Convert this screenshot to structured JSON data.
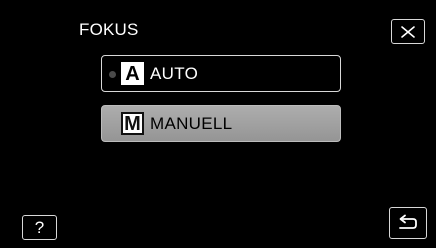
{
  "screen": {
    "title": "FOKUS"
  },
  "options": [
    {
      "label": "AUTO",
      "badge": "A",
      "state": "selected-indicator",
      "style": "dark"
    },
    {
      "label": "MANUELL",
      "badge": "M",
      "state": "highlighted",
      "style": "gray"
    }
  ],
  "controls": {
    "close_icon": "close-icon",
    "help_label": "?",
    "help_icon": "question-mark-icon",
    "back_icon": "return-arrow-icon"
  },
  "colors": {
    "background": "#000000",
    "text_light": "#ffffff",
    "border_light": "#d8d8d8",
    "highlight_gray": "#a5a5a5",
    "dot_gray": "#4a4a4a"
  }
}
